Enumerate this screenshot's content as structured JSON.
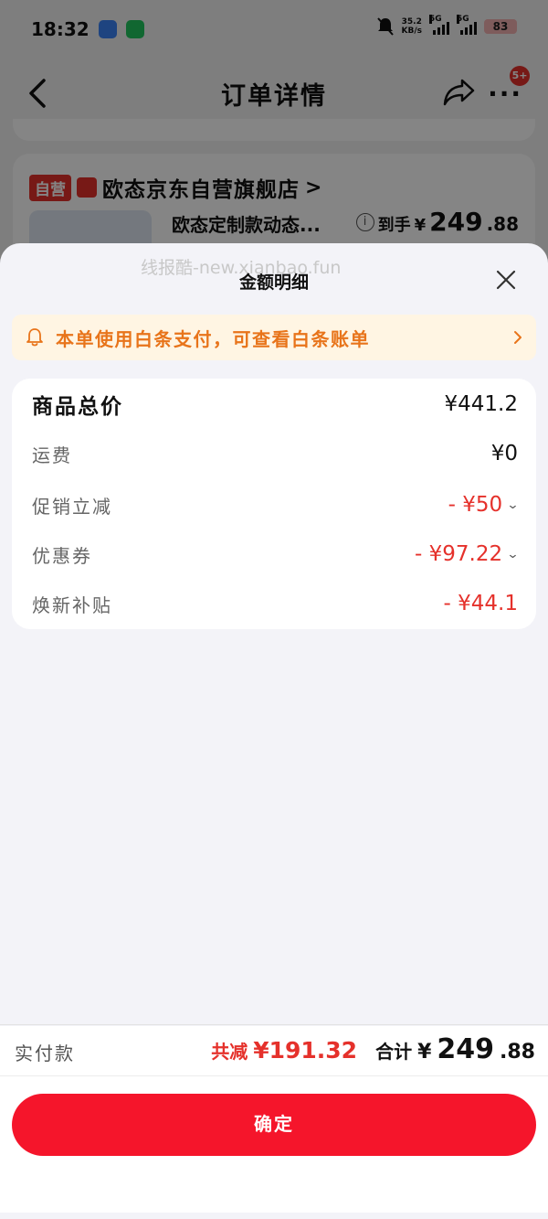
{
  "status_bar": {
    "time": "18:32",
    "speed_value": "35.2",
    "speed_unit": "KB/s",
    "signal1_label": "5G",
    "signal2_label": "5G",
    "battery": "83"
  },
  "nav": {
    "title": "订单详情",
    "badge": "5+",
    "more": "···"
  },
  "background_card": {
    "self_tag": "自营",
    "store_name": "欧态京东自营旗舰店",
    "store_arrow": ">",
    "product_name": "欧态定制款动态...",
    "price_label": "到手",
    "price_yen": "¥",
    "price_int": "249",
    "price_dec": ".88"
  },
  "sheet": {
    "watermark": "线报酷-new.xianbao.fun",
    "title": "金额明细",
    "notice": "本单使用白条支付，可查看白条账单",
    "rows": [
      {
        "label": "商品总价",
        "value": "¥441.2"
      },
      {
        "label": "运费",
        "value": "¥0"
      },
      {
        "label": "促销立减",
        "value": "- ¥50"
      },
      {
        "label": "优惠券",
        "value": "- ¥97.22"
      },
      {
        "label": "焕新补贴",
        "value": "- ¥44.1"
      }
    ],
    "footer": {
      "pay_label": "实付款",
      "saved_label": "共减",
      "saved_value": "¥191.32",
      "total_label": "合计",
      "total_yen": "¥",
      "total_int": "249",
      "total_dec": ".88"
    },
    "confirm_label": "确定"
  },
  "colors": {
    "accent_red": "#f5152b",
    "discount_red": "#e5312b",
    "notice_orange": "#e8741a",
    "notice_bg": "#fff5e3"
  }
}
